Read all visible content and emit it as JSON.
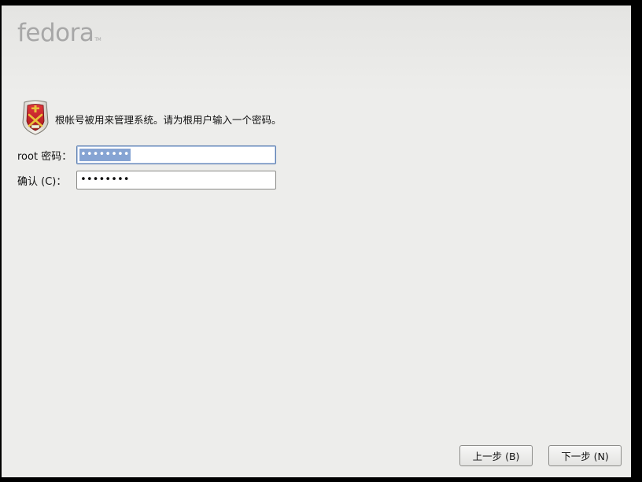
{
  "header": {
    "logo_text": "fedora",
    "logo_tm": "TM"
  },
  "intro": {
    "icon": "root-shield-icon",
    "text": "根帐号被用来管理系统。请为根用户输入一个密码。"
  },
  "form": {
    "root_password": {
      "label": "root 密码：",
      "value": "••••••••"
    },
    "confirm_password": {
      "label": "确认 (C)：",
      "value": "••••••••"
    }
  },
  "buttons": {
    "back_label": "上一步 (B)",
    "next_label": "下一步 (N)"
  },
  "colors": {
    "window_bg": "#ededeb",
    "selection": "#86a4d3",
    "shield_red": "#c8232a",
    "shield_gold": "#e8c23a"
  }
}
